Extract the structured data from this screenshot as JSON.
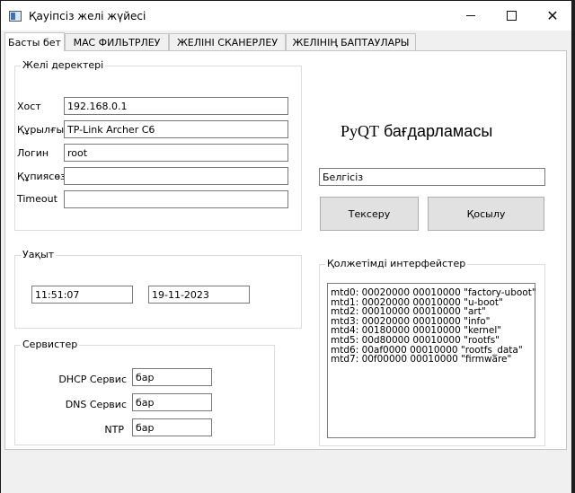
{
  "window": {
    "title": "Қауіпсіз желі жүйесі",
    "min_label": "—",
    "max_label": "□",
    "close_label": "✕"
  },
  "tabs": [
    {
      "label": "Басты бет",
      "active": true
    },
    {
      "label": "MAC ФИЛЬТРЛЕУ",
      "active": false
    },
    {
      "label": "ЖЕЛІНІ  СКАНЕРЛЕУ",
      "active": false
    },
    {
      "label": "ЖЕЛІНІҢ БАПТАУЛАРЫ",
      "active": false
    }
  ],
  "network": {
    "group_title": "Желі деректері",
    "fields": [
      {
        "label": "Хост",
        "value": "192.168.0.1"
      },
      {
        "label": "Құрылғы",
        "value": "TP-Link Archer C6"
      },
      {
        "label": "Логин",
        "value": "root"
      },
      {
        "label": "Құпиясөз",
        "value": ""
      },
      {
        "label": "Timeout",
        "value": ""
      }
    ]
  },
  "header": {
    "pyqt": "PyQT",
    "program": "бағдарламасы"
  },
  "status_field": {
    "value": "Белгісіз"
  },
  "buttons": {
    "check": "Тексеру",
    "connect": "Қосылу"
  },
  "time": {
    "group_title": "Уақыт",
    "clock": "11:51:07",
    "date": "19-11-2023"
  },
  "services": {
    "group_title": "Сервистер",
    "items": [
      {
        "label": "DHCP Сервис",
        "value": "бар"
      },
      {
        "label": "DNS Сервис",
        "value": "бар"
      },
      {
        "label": "NTP",
        "value": "бар"
      }
    ]
  },
  "interfaces": {
    "group_title": "Қолжетімді интерфейстер",
    "lines": [
      "mtd0: 00020000 00010000 \"factory-uboot\"",
      "mtd1: 00020000 00010000 \"u-boot\"",
      "mtd2: 00010000 00010000 \"art\"",
      "mtd3: 00020000 00010000 \"info\"",
      "mtd4: 00180000 00010000 \"kernel\"",
      "mtd5: 00d80000 00010000 \"rootfs\"",
      "mtd6: 00af0000 00010000 \"rootfs_data\"",
      "mtd7: 00f00000 00010000 \"firmware\""
    ]
  }
}
